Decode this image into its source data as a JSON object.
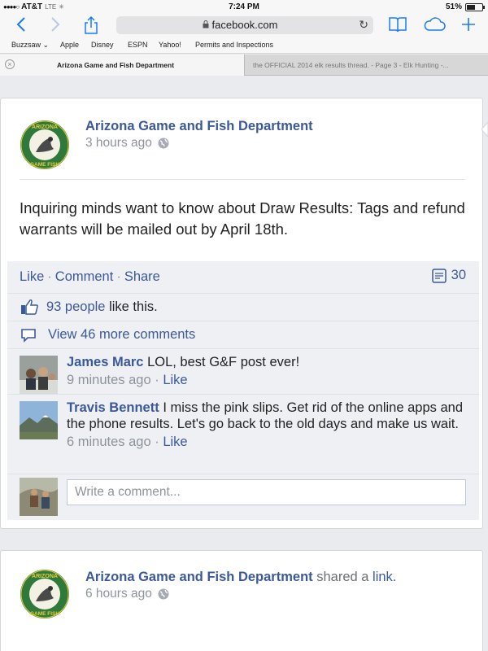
{
  "status_bar": {
    "carrier": "AT&T",
    "network": "LTE",
    "time": "7:24 PM",
    "battery": "51%"
  },
  "browser": {
    "url": "facebook.com",
    "bookmarks": [
      "Buzzsaw ⌄",
      "Apple",
      "Disney",
      "ESPN",
      "Yahoo!",
      "Permits and Inspections"
    ],
    "tabs": [
      {
        "title": "Arizona Game and Fish Department",
        "active": true
      },
      {
        "title": "the OFFICIAL 2014 elk results thread. - Page 3 - Elk Hunting -...",
        "active": false
      }
    ]
  },
  "colors": {
    "facebook_blue": "#3b5998",
    "ios_blue": "#1a7cf7",
    "feed_bg": "#e9ebee"
  },
  "post": {
    "page_name": "Arizona Game and Fish Department",
    "time": "3 hours ago",
    "text": "Inquiring minds want to know about Draw Results: Tags and refund warrants will be mailed out by April 18th.",
    "actions": {
      "like": "Like",
      "comment": "Comment",
      "share": "Share",
      "separator": "·",
      "comment_count": "30"
    },
    "likes": {
      "count_text": "93 people",
      "suffix": "like this."
    },
    "view_more": "View 46 more comments",
    "comments": [
      {
        "author": "James Marc",
        "text": "LOL, best G&F post ever!",
        "time": "9 minutes ago",
        "like": "Like"
      },
      {
        "author": "Travis Bennett",
        "text": "I miss the pink slips. Get rid of the online apps and the phone results. Let's go back to the old days and make us wait.",
        "time": "6 minutes ago",
        "like": "Like"
      }
    ],
    "write_placeholder": "Write a comment..."
  },
  "post2": {
    "page_name": "Arizona Game and Fish Department",
    "shared_text": "shared a",
    "shared_link": "link.",
    "time": "6 hours ago"
  }
}
